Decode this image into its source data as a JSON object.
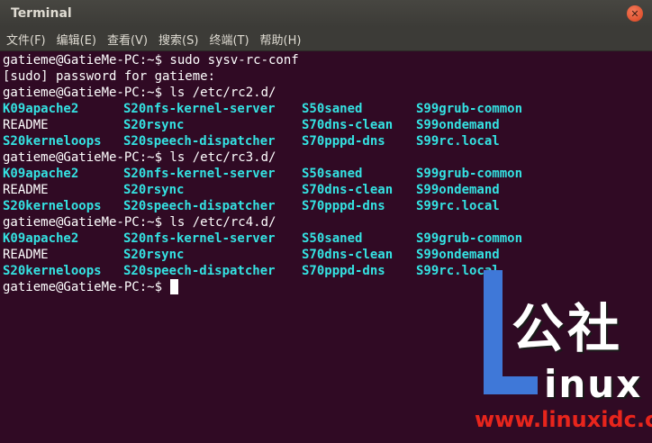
{
  "window": {
    "title": "Terminal"
  },
  "menu": [
    "文件(F)",
    "编辑(E)",
    "查看(V)",
    "搜索(S)",
    "终端(T)",
    "帮助(H)"
  ],
  "colors": {
    "background": "#300a24",
    "text": "#ffffff",
    "highlight": "#34e2e2"
  },
  "terminal": {
    "lines": [
      {
        "type": "text",
        "text": "gatieme@GatieMe-PC:~$ sudo sysv-rc-conf"
      },
      {
        "type": "text",
        "text": "[sudo] password for gatieme:"
      },
      {
        "type": "text",
        "text": "gatieme@GatieMe-PC:~$ ls /etc/rc2.d/"
      },
      {
        "type": "cols",
        "cells": [
          {
            "t": "K09apache2",
            "hl": true
          },
          {
            "t": "S20nfs-kernel-server",
            "hl": true
          },
          {
            "t": "S50saned",
            "hl": true
          },
          {
            "t": "S99grub-common",
            "hl": true
          }
        ]
      },
      {
        "type": "cols",
        "cells": [
          {
            "t": "README",
            "hl": false
          },
          {
            "t": "S20rsync",
            "hl": true
          },
          {
            "t": "S70dns-clean",
            "hl": true
          },
          {
            "t": "S99ondemand",
            "hl": true
          }
        ]
      },
      {
        "type": "cols",
        "cells": [
          {
            "t": "S20kerneloops",
            "hl": true
          },
          {
            "t": "S20speech-dispatcher",
            "hl": true
          },
          {
            "t": "S70pppd-dns",
            "hl": true
          },
          {
            "t": "S99rc.local",
            "hl": true
          }
        ]
      },
      {
        "type": "text",
        "text": "gatieme@GatieMe-PC:~$ ls /etc/rc3.d/"
      },
      {
        "type": "cols",
        "cells": [
          {
            "t": "K09apache2",
            "hl": true
          },
          {
            "t": "S20nfs-kernel-server",
            "hl": true
          },
          {
            "t": "S50saned",
            "hl": true
          },
          {
            "t": "S99grub-common",
            "hl": true
          }
        ]
      },
      {
        "type": "cols",
        "cells": [
          {
            "t": "README",
            "hl": false
          },
          {
            "t": "S20rsync",
            "hl": true
          },
          {
            "t": "S70dns-clean",
            "hl": true
          },
          {
            "t": "S99ondemand",
            "hl": true
          }
        ]
      },
      {
        "type": "cols",
        "cells": [
          {
            "t": "S20kerneloops",
            "hl": true
          },
          {
            "t": "S20speech-dispatcher",
            "hl": true
          },
          {
            "t": "S70pppd-dns",
            "hl": true
          },
          {
            "t": "S99rc.local",
            "hl": true
          }
        ]
      },
      {
        "type": "text",
        "text": "gatieme@GatieMe-PC:~$ ls /etc/rc4.d/"
      },
      {
        "type": "cols",
        "cells": [
          {
            "t": "K09apache2",
            "hl": true
          },
          {
            "t": "S20nfs-kernel-server",
            "hl": true
          },
          {
            "t": "S50saned",
            "hl": true
          },
          {
            "t": "S99grub-common",
            "hl": true
          }
        ]
      },
      {
        "type": "cols",
        "cells": [
          {
            "t": "README",
            "hl": false
          },
          {
            "t": "S20rsync",
            "hl": true
          },
          {
            "t": "S70dns-clean",
            "hl": true
          },
          {
            "t": "S99ondemand",
            "hl": true
          }
        ]
      },
      {
        "type": "cols",
        "cells": [
          {
            "t": "S20kerneloops",
            "hl": true
          },
          {
            "t": "S20speech-dispatcher",
            "hl": true
          },
          {
            "t": "S70pppd-dns",
            "hl": true
          },
          {
            "t": "S99rc.local",
            "hl": true
          }
        ]
      },
      {
        "type": "prompt",
        "text": "gatieme@GatieMe-PC:~$ "
      }
    ]
  },
  "watermark": {
    "top": "公社",
    "bottom": "inux",
    "url": "www.linuxidc.com"
  }
}
